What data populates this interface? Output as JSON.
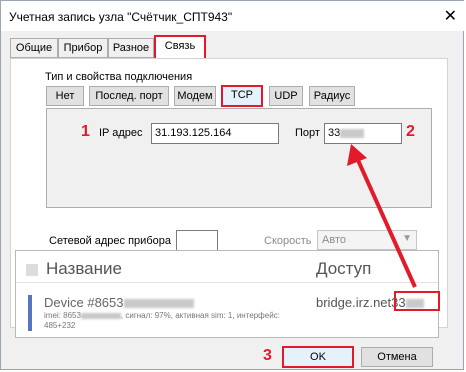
{
  "window": {
    "title": "Учетная запись узла \"Счётчик_СПТ943\"",
    "close_glyph": "✕"
  },
  "tabs": [
    {
      "label": "Общие"
    },
    {
      "label": "Прибор"
    },
    {
      "label": "Разное"
    },
    {
      "label": "Связь",
      "active": true
    }
  ],
  "connection": {
    "group_label": "Тип и свойства подключения",
    "types": [
      "Нет",
      "Послед. порт",
      "Модем",
      "TCP",
      "UDP",
      "Радиус"
    ],
    "selected": "TCP"
  },
  "tcp": {
    "ip_label": "IP адрес",
    "ip_value": "31.193.125.164",
    "port_label": "Порт",
    "port_value": "33"
  },
  "network": {
    "address_label": "Сетевой адрес прибора",
    "address_value": "",
    "speed_label": "Скорость",
    "speed_value": "Авто"
  },
  "buttons": {
    "ok": "OK",
    "cancel": "Отмена"
  },
  "annotations": {
    "n1": "1",
    "n2": "2",
    "n3": "3",
    "color": "#e21b2a"
  },
  "overlay": {
    "col_name": "Название",
    "col_access": "Доступ",
    "device_name": "Device #8653",
    "device_details_1": "imei: 8653",
    "device_details_1b": ", сигнал: 97%, активная sim: 1, интерфейс:",
    "device_details_2": "485+232",
    "access_host": "bridge.irz.net",
    "access_port": "33",
    "accent": "#5674c2"
  }
}
